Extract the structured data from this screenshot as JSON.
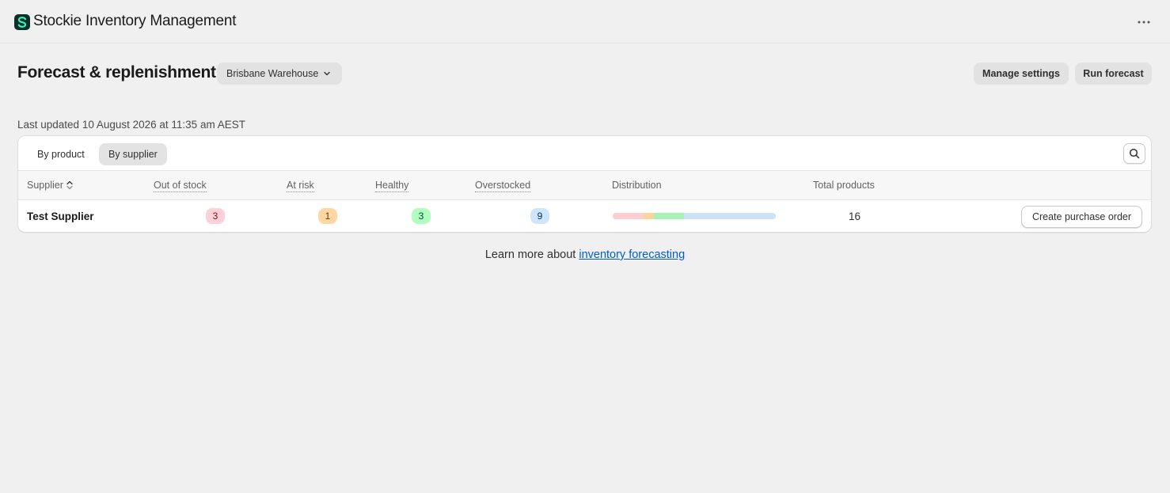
{
  "app": {
    "title": "Stockie Inventory Management",
    "logo_icon": "stockie-logo-icon",
    "more_icon": "ellipsis-icon"
  },
  "header": {
    "title": "Forecast & replenishment",
    "location": "Brisbane Warehouse",
    "manage_settings": "Manage settings",
    "run_forecast": "Run forecast"
  },
  "last_updated": "Last updated 10 August 2026 at 11:35 am AEST",
  "tabs": [
    {
      "label": "By product",
      "selected": false
    },
    {
      "label": "By supplier",
      "selected": true
    }
  ],
  "table": {
    "columns": {
      "supplier": "Supplier",
      "out_of_stock": "Out of stock",
      "at_risk": "At risk",
      "healthy": "Healthy",
      "overstocked": "Overstocked",
      "distribution": "Distribution",
      "total_products": "Total products"
    },
    "rows": [
      {
        "supplier": "Test Supplier",
        "out_of_stock": "3",
        "at_risk": "1",
        "healthy": "3",
        "overstocked": "9",
        "total_products": "16",
        "distribution": [
          {
            "status": "out_of_stock",
            "count": 3,
            "color": "#fecdd2"
          },
          {
            "status": "at_risk",
            "count": 1,
            "color": "#fdd49e"
          },
          {
            "status": "healthy",
            "count": 3,
            "color": "#a7f3b5"
          },
          {
            "status": "overstocked",
            "count": 9,
            "color": "#cde3f8"
          }
        ],
        "action": "Create purchase order"
      }
    ]
  },
  "footer": {
    "learn_more_prefix": "Learn more about ",
    "learn_more_link": "inventory forecasting"
  },
  "colors": {
    "accent_link": "#005bd3",
    "badge_out_of_stock": "#fed1d7",
    "badge_at_risk": "#ffd6a4",
    "badge_healthy": "#affebf",
    "badge_overstocked": "#cfe5fb"
  }
}
